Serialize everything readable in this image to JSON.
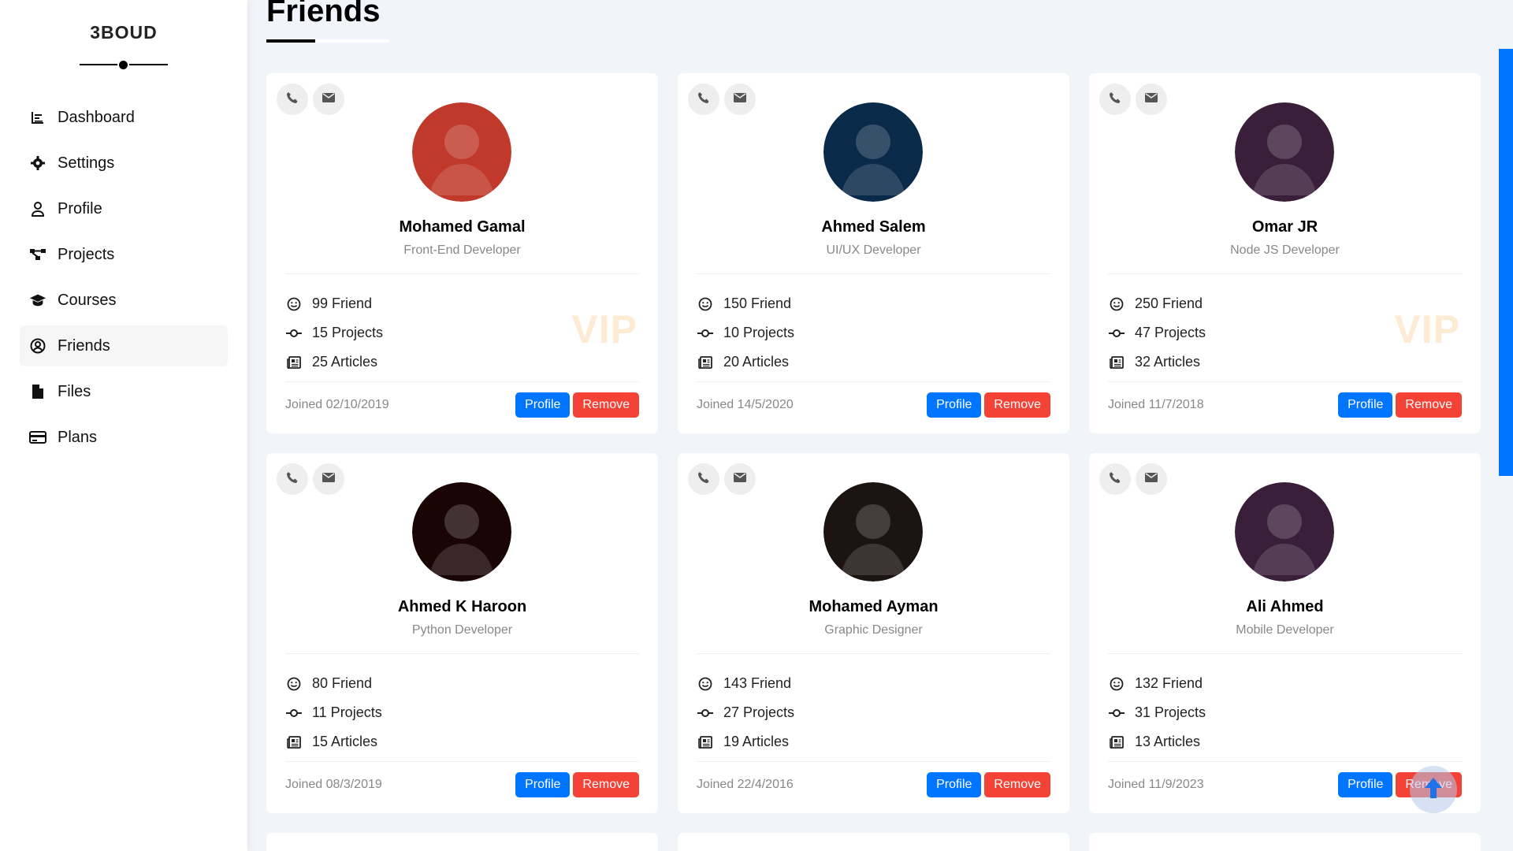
{
  "sidebar": {
    "brand": "3BOUD",
    "items": [
      {
        "label": "Dashboard",
        "icon": "chart-icon"
      },
      {
        "label": "Settings",
        "icon": "gear-icon"
      },
      {
        "label": "Profile",
        "icon": "user-icon"
      },
      {
        "label": "Projects",
        "icon": "diagram-icon"
      },
      {
        "label": "Courses",
        "icon": "graduation-cap-icon"
      },
      {
        "label": "Friends",
        "icon": "user-circle-icon",
        "active": true
      },
      {
        "label": "Files",
        "icon": "file-icon"
      },
      {
        "label": "Plans",
        "icon": "credit-card-icon"
      }
    ]
  },
  "page": {
    "title": "Friends"
  },
  "friends": [
    {
      "name": "Mohamed Gamal",
      "job": "Front-End Developer",
      "friends": "99 Friend",
      "projects": "15 Projects",
      "articles": "25 Articles",
      "joined": "Joined 02/10/2019",
      "vip": "VIP",
      "profile_label": "Profile",
      "remove_label": "Remove",
      "avatar_color": "#c0392b"
    },
    {
      "name": "Ahmed Salem",
      "job": "UI/UX Developer",
      "friends": "150 Friend",
      "projects": "10 Projects",
      "articles": "20 Articles",
      "joined": "Joined 14/5/2020",
      "vip": "",
      "profile_label": "Profile",
      "remove_label": "Remove",
      "avatar_color": "#0a2a4a"
    },
    {
      "name": "Omar JR",
      "job": "Node JS Developer",
      "friends": "250 Friend",
      "projects": "47 Projects",
      "articles": "32 Articles",
      "joined": "Joined 11/7/2018",
      "vip": "VIP",
      "profile_label": "Profile",
      "remove_label": "Remove",
      "avatar_color": "#3a1f3a"
    },
    {
      "name": "Ahmed K Haroon",
      "job": "Python Developer",
      "friends": "80 Friend",
      "projects": "11 Projects",
      "articles": "15 Articles",
      "joined": "Joined 08/3/2019",
      "vip": "",
      "profile_label": "Profile",
      "remove_label": "Remove",
      "avatar_color": "#1a0505"
    },
    {
      "name": "Mohamed Ayman",
      "job": "Graphic Designer",
      "friends": "143 Friend",
      "projects": "27 Projects",
      "articles": "19 Articles",
      "joined": "Joined 22/4/2016",
      "vip": "",
      "profile_label": "Profile",
      "remove_label": "Remove",
      "avatar_color": "#1c1410"
    },
    {
      "name": "Ali Ahmed",
      "job": "Mobile Developer",
      "friends": "132 Friend",
      "projects": "31 Projects",
      "articles": "13 Articles",
      "joined": "Joined 11/9/2023",
      "vip": "",
      "profile_label": "Profile",
      "remove_label": "Remove",
      "avatar_color": "#3a1f3a"
    }
  ],
  "colors": {
    "accent": "#0075ff",
    "danger": "#f44336",
    "vip": "#fdebd3",
    "background": "#f1f5f9"
  }
}
